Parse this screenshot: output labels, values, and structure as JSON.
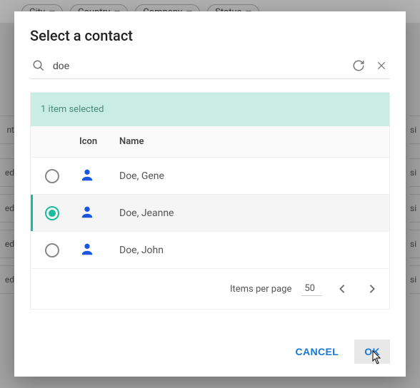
{
  "background": {
    "chips": [
      "City",
      "Country",
      "Company",
      "Status"
    ],
    "left_cells": [
      "nt",
      "ed",
      "ed",
      "ed",
      "ed"
    ],
    "right_cells": [
      "si",
      "si",
      "si",
      "si",
      "si"
    ]
  },
  "modal": {
    "title": "Select a contact",
    "search": {
      "value": "doe",
      "placeholder": ""
    },
    "selection_text": "1 item selected",
    "columns": {
      "icon": "Icon",
      "name": "Name"
    },
    "rows": [
      {
        "name": "Doe, Gene",
        "selected": false
      },
      {
        "name": "Doe, Jeanne",
        "selected": true
      },
      {
        "name": "Doe, John",
        "selected": false
      }
    ],
    "pagination": {
      "label": "Items per page",
      "size": "50"
    },
    "actions": {
      "cancel": "CANCEL",
      "ok": "OK"
    }
  }
}
